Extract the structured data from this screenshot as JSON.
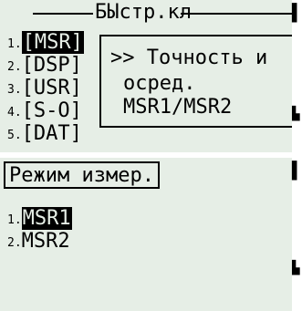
{
  "top_screen": {
    "title": "БЫстр.кл",
    "menu_items": [
      {
        "num": "1.",
        "label": "[MSR]",
        "selected": true
      },
      {
        "num": "2.",
        "label": "[DSP]",
        "selected": false
      },
      {
        "num": "3.",
        "label": "[USR]",
        "selected": false
      },
      {
        "num": "4.",
        "label": "[S-O]",
        "selected": false
      },
      {
        "num": "5.",
        "label": "[DAT]",
        "selected": false
      }
    ],
    "popup_lines": [
      ">> Точность и",
      "оcред.",
      "MSR1/MSR2"
    ]
  },
  "bottom_screen": {
    "mode_title": "Режим измер.",
    "options": [
      {
        "num": "1.",
        "label": "MSR1",
        "selected": true
      },
      {
        "num": "2.",
        "label": "MSR2",
        "selected": false
      }
    ]
  },
  "colors": {
    "lcd_background": "#e6eee6",
    "pixel": "#000000"
  }
}
